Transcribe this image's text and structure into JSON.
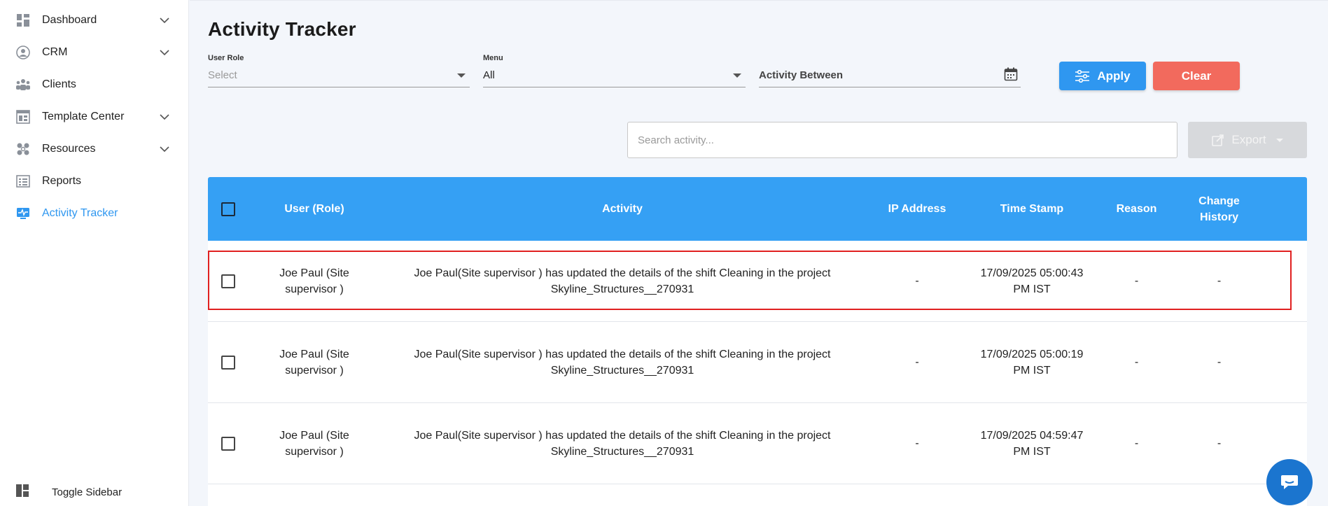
{
  "sidebar": {
    "items": [
      {
        "label": "Dashboard",
        "icon": "dashboard-icon",
        "expandable": true
      },
      {
        "label": "CRM",
        "icon": "crm-icon",
        "expandable": true
      },
      {
        "label": "Clients",
        "icon": "clients-icon",
        "expandable": false
      },
      {
        "label": "Template Center",
        "icon": "template-icon",
        "expandable": true
      },
      {
        "label": "Resources",
        "icon": "resources-icon",
        "expandable": true
      },
      {
        "label": "Reports",
        "icon": "reports-icon",
        "expandable": false
      },
      {
        "label": "Activity Tracker",
        "icon": "activity-icon",
        "expandable": false,
        "active": true
      }
    ],
    "toggle_label": "Toggle Sidebar"
  },
  "page": {
    "title": "Activity Tracker"
  },
  "filters": {
    "user_role": {
      "label": "User Role",
      "placeholder": "Select"
    },
    "menu": {
      "label": "Menu",
      "value": "All"
    },
    "activity_between": {
      "placeholder": "Activity Between"
    },
    "apply_label": "Apply",
    "clear_label": "Clear"
  },
  "search": {
    "placeholder": "Search activity..."
  },
  "export_label": "Export",
  "table": {
    "headers": {
      "user": "User (Role)",
      "activity": "Activity",
      "ip": "IP Address",
      "timestamp": "Time Stamp",
      "reason": "Reason",
      "change_history_1": "Change",
      "change_history_2": "History"
    },
    "rows": [
      {
        "user_1": "Joe Paul  (Site",
        "user_2": "supervisor )",
        "activity_1": "Joe Paul(Site supervisor ) has updated the details of the shift Cleaning in the project",
        "activity_2": "Skyline_Structures__270931",
        "ip": "-",
        "ts_1": "17/09/2025 05:00:43",
        "ts_2": "PM IST",
        "reason": "-",
        "change_history": "-"
      },
      {
        "user_1": "Joe Paul  (Site",
        "user_2": "supervisor )",
        "activity_1": "Joe Paul(Site supervisor ) has updated the details of the shift Cleaning in the project",
        "activity_2": "Skyline_Structures__270931",
        "ip": "-",
        "ts_1": "17/09/2025 05:00:19",
        "ts_2": "PM IST",
        "reason": "-",
        "change_history": "-"
      },
      {
        "user_1": "Joe Paul  (Site",
        "user_2": "supervisor )",
        "activity_1": "Joe Paul(Site supervisor ) has updated the details of the shift Cleaning in the project",
        "activity_2": "Skyline_Structures__270931",
        "ip": "-",
        "ts_1": "17/09/2025 04:59:47",
        "ts_2": "PM IST",
        "reason": "-",
        "change_history": "-"
      }
    ]
  },
  "colors": {
    "accent": "#2f97f0",
    "header": "#35a0f4",
    "clear": "#f26a5d",
    "highlight": "#e02020",
    "chat": "#1b75cf"
  }
}
